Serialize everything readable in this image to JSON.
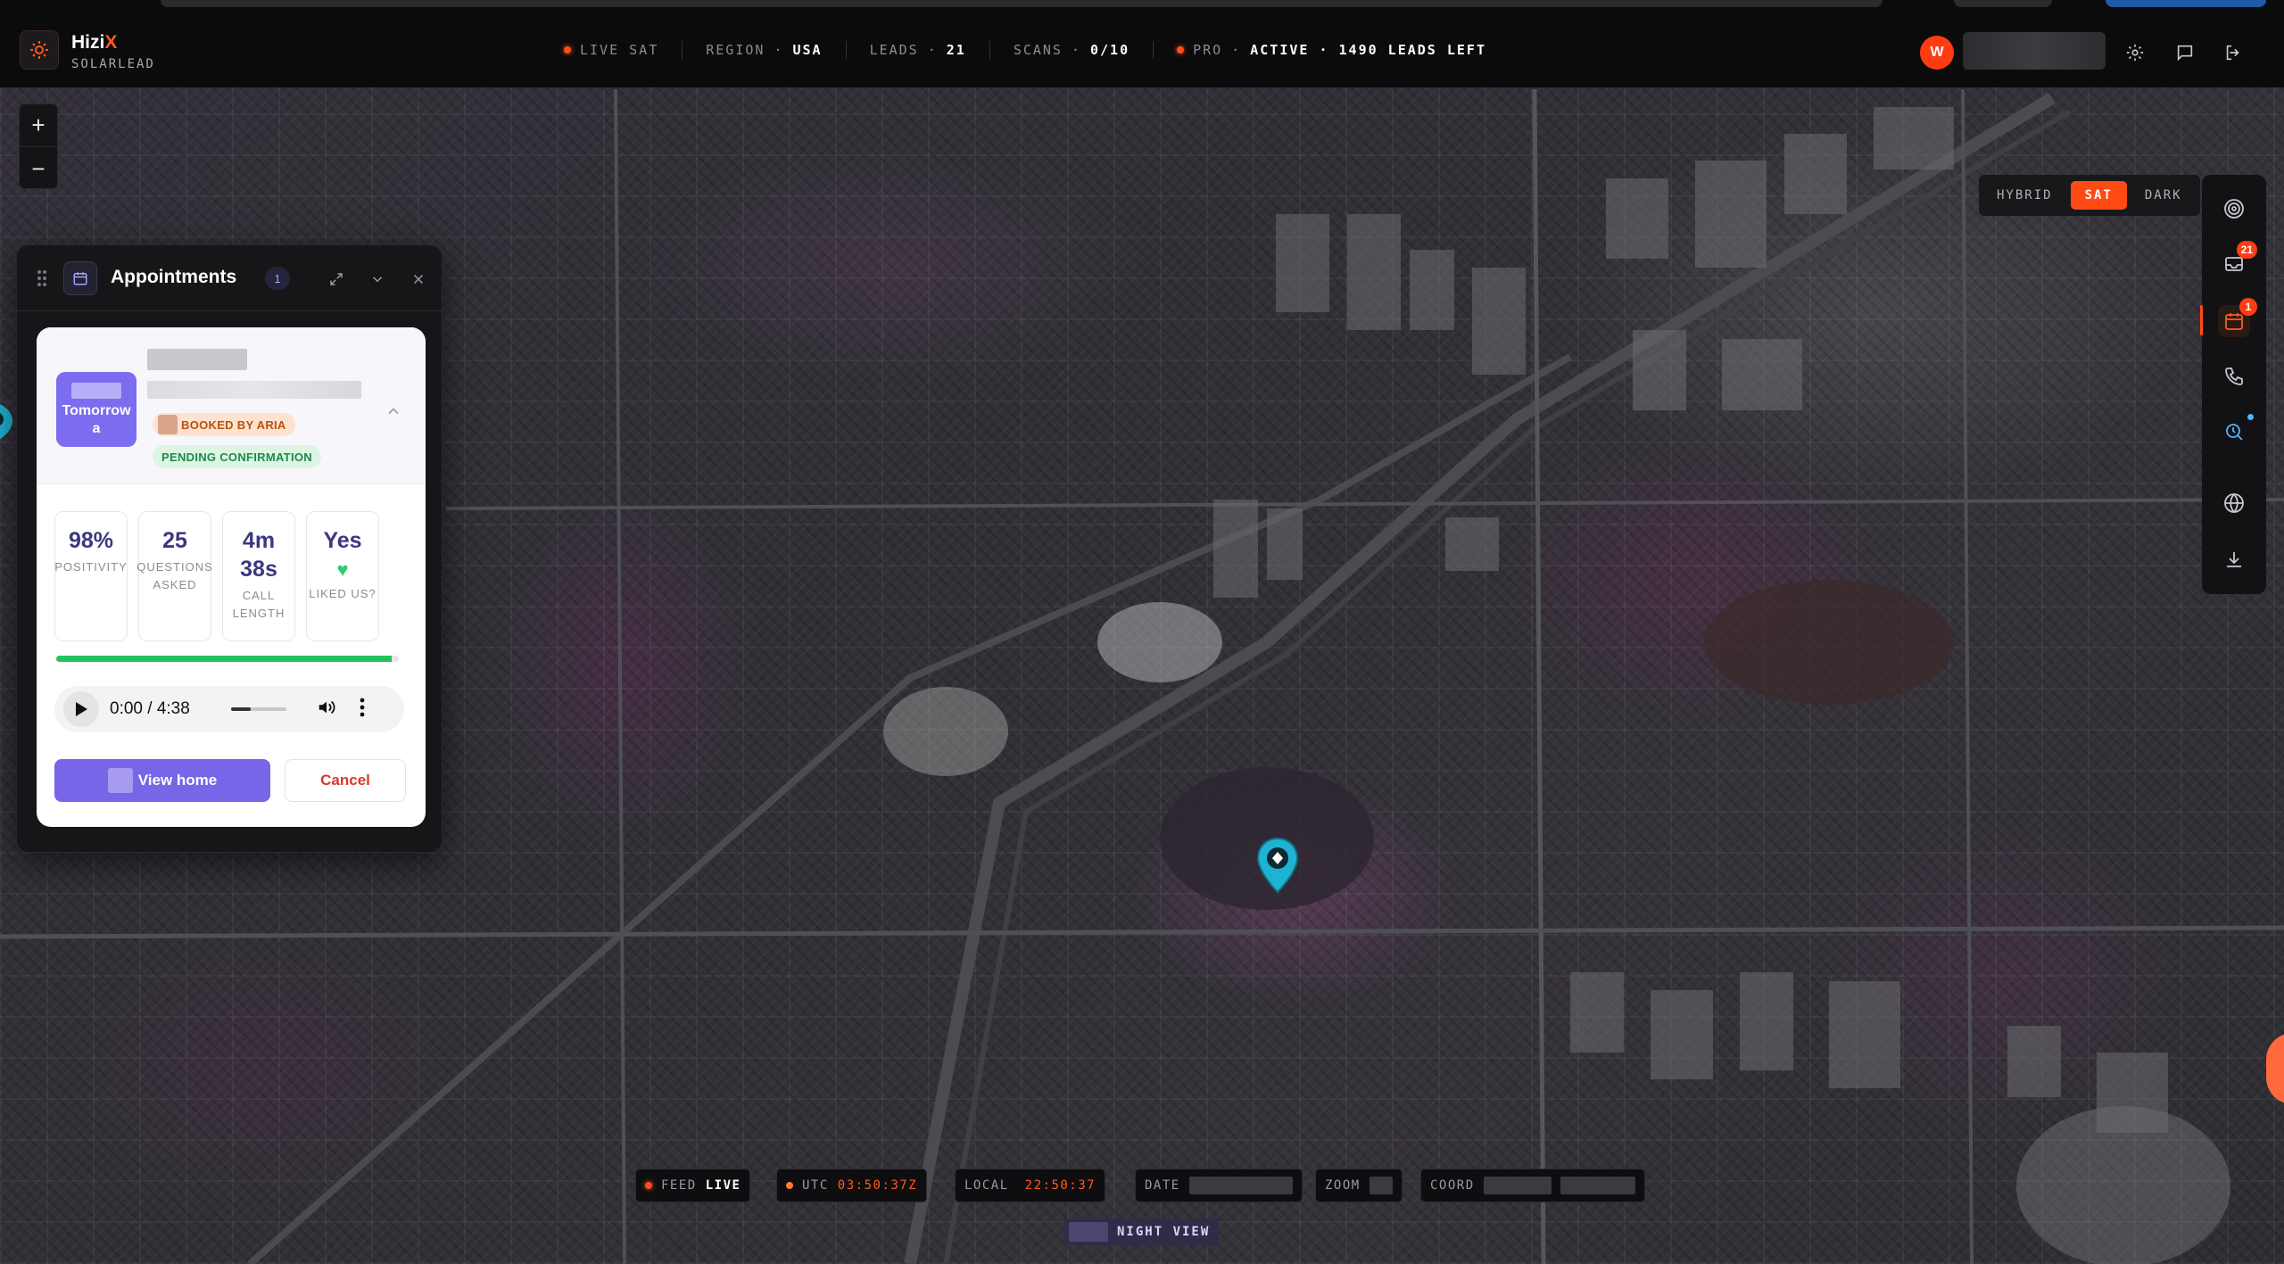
{
  "app": {
    "brand_name": "Hizi",
    "brand_x": "X",
    "brand_sub": "SOLARLEAD"
  },
  "status_bar": {
    "live_sat": "LIVE SAT",
    "region_label": "REGION",
    "region_value": "USA",
    "leads_label": "LEADS",
    "leads_value": "21",
    "scans_label": "SCANS",
    "scans_value": "0/10",
    "pro_label": "PRO",
    "pro_value": "ACTIVE · 1490 LEADS LEFT",
    "separator": "·"
  },
  "user": {
    "avatar_initial": "W"
  },
  "map_style": {
    "options": [
      "HYBRID",
      "SAT",
      "DARK"
    ],
    "active": "SAT"
  },
  "zoom": {
    "in": "+",
    "out": "−"
  },
  "rail": {
    "leads_badge": "21",
    "appointments_badge": "1",
    "icons": [
      "target-icon",
      "inbox-icon",
      "calendar-icon",
      "phone-icon",
      "search-time-icon",
      "globe-icon",
      "download-icon"
    ]
  },
  "appointments": {
    "title": "Appointments",
    "count": "1",
    "card": {
      "date_label": "Tomorrow",
      "date_sub": "a",
      "tag_booked": "BOOKED BY ARIA",
      "tag_pending": "PENDING CONFIRMATION",
      "stats": [
        {
          "value": "98%",
          "label": "POSITIVITY"
        },
        {
          "value": "25",
          "label": "QUESTIONS ASKED"
        },
        {
          "value": "4m 38s",
          "label": "CALL LENGTH"
        },
        {
          "value": "Yes",
          "label": "LIKED US?"
        }
      ],
      "positivity_fraction": 0.98,
      "audio_time": "0:00 / 4:38",
      "view_home": "View home",
      "cancel": "Cancel"
    }
  },
  "hud": {
    "feed_label": "FEED",
    "feed_value": "LIVE",
    "utc_label": "UTC",
    "utc_value": "03:50:37Z",
    "local_label": "LOCAL",
    "local_value": "22:50:37",
    "date_label": "DATE",
    "zoom_label": "ZOOM",
    "coord_label": "COORD",
    "night_view": "NIGHT VIEW"
  },
  "colors": {
    "accent": "#ff4a14",
    "purple": "#7766e8",
    "marker": "#1fb3d3"
  }
}
